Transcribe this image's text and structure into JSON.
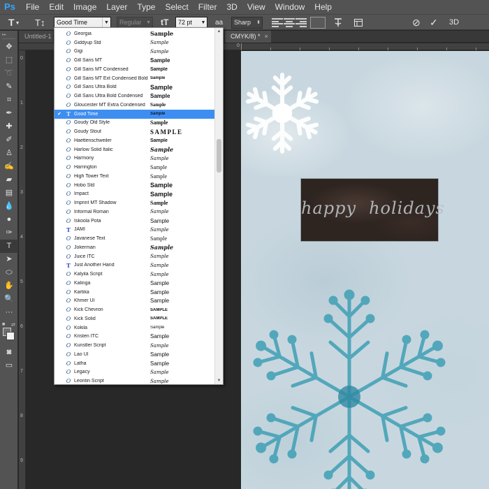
{
  "app": {
    "logo": "Ps"
  },
  "menu": [
    "File",
    "Edit",
    "Image",
    "Layer",
    "Type",
    "Select",
    "Filter",
    "3D",
    "View",
    "Window",
    "Help"
  ],
  "options": {
    "tool_preset": "T",
    "orientation_icon": "T↕",
    "font_family": "Good Time",
    "font_style": "Regular",
    "size_icon": "tT",
    "font_size": "72 pt",
    "aa_icon": "aa",
    "anti_alias": "Sharp",
    "align_options": [
      "align-left",
      "align-center",
      "align-right"
    ],
    "text_color": "#595959",
    "cancel_icon": "⊘",
    "commit_icon": "✓",
    "threed_label": "3D"
  },
  "tabs": [
    {
      "label": "Untitled-1"
    },
    {
      "label": "CMYK/8) *",
      "close": "×"
    }
  ],
  "rulers": {
    "top": [
      "0"
    ],
    "left": [
      "0",
      "1",
      "2",
      "3",
      "4",
      "5",
      "6",
      "7",
      "8",
      "9"
    ]
  },
  "tools": [
    "move",
    "marquee",
    "lasso",
    "quick-select",
    "crop",
    "eyedropper",
    "healing",
    "brush",
    "stamp",
    "history-brush",
    "eraser",
    "gradient",
    "blur",
    "dodge",
    "pen",
    "type",
    "path-select",
    "shape",
    "hand",
    "zoom"
  ],
  "canvas": {
    "text_word1": "happy",
    "text_word2": "holidays",
    "colors": {
      "background": "#c8d7df",
      "box": "#2e2420",
      "snow_blue": "#3f9fb5",
      "snow_white": "#ffffff"
    }
  },
  "font_menu": {
    "selected": "Good Time",
    "fonts": [
      {
        "name": "Georgia",
        "sample": "Sample",
        "type": "opentype"
      },
      {
        "name": "Giddyup Std",
        "sample": "Sample",
        "type": "opentype"
      },
      {
        "name": "Gigi",
        "sample": "Sample",
        "type": "opentype"
      },
      {
        "name": "Gill Sans MT",
        "sample": "Sample",
        "type": "opentype"
      },
      {
        "name": "Gill Sans MT Condensed",
        "sample": "Sample",
        "type": "opentype"
      },
      {
        "name": "Gill Sans MT Ext Condensed Bold",
        "sample": "Sample",
        "type": "opentype"
      },
      {
        "name": "Gill Sans Ultra Bold",
        "sample": "Sample",
        "type": "opentype"
      },
      {
        "name": "Gill Sans Ultra Bold Condensed",
        "sample": "Sample",
        "type": "opentype"
      },
      {
        "name": "Gloucester MT Extra Condensed",
        "sample": "Sample",
        "type": "opentype"
      },
      {
        "name": "Good Time",
        "sample": "Sample",
        "type": "truetype",
        "checked": true
      },
      {
        "name": "Goudy Old Style",
        "sample": "Sample",
        "type": "opentype"
      },
      {
        "name": "Goudy Stout",
        "sample": "SAMPLE",
        "type": "opentype"
      },
      {
        "name": "Haettenschweiler",
        "sample": "Sample",
        "type": "opentype"
      },
      {
        "name": "Harlow Solid Italic",
        "sample": "Sample",
        "type": "opentype"
      },
      {
        "name": "Harmony",
        "sample": "Sample",
        "type": "opentype"
      },
      {
        "name": "Harrington",
        "sample": "Sample",
        "type": "opentype"
      },
      {
        "name": "High Tower Text",
        "sample": "Sample",
        "type": "opentype"
      },
      {
        "name": "Hobo Std",
        "sample": "Sample",
        "type": "opentype"
      },
      {
        "name": "Impact",
        "sample": "Sample",
        "type": "opentype"
      },
      {
        "name": "Imprint MT Shadow",
        "sample": "Sample",
        "type": "opentype"
      },
      {
        "name": "Informal Roman",
        "sample": "Sample",
        "type": "opentype"
      },
      {
        "name": "Iskoola Pota",
        "sample": "Sample",
        "type": "opentype"
      },
      {
        "name": "JAMI",
        "sample": "Sample",
        "type": "truetype"
      },
      {
        "name": "Javanese Text",
        "sample": "Sample",
        "type": "opentype"
      },
      {
        "name": "Jokerman",
        "sample": "Sample",
        "type": "opentype"
      },
      {
        "name": "Juice ITC",
        "sample": "Sample",
        "type": "opentype"
      },
      {
        "name": "Just Another Hand",
        "sample": "Sample",
        "type": "truetype"
      },
      {
        "name": "Kalyila Script",
        "sample": "Sample",
        "type": "opentype"
      },
      {
        "name": "Kalinga",
        "sample": "Sample",
        "type": "opentype"
      },
      {
        "name": "Kartika",
        "sample": "Sample",
        "type": "opentype"
      },
      {
        "name": "Khmer UI",
        "sample": "Sample",
        "type": "opentype"
      },
      {
        "name": "Kick Chevron",
        "sample": "SAMPLE",
        "type": "opentype"
      },
      {
        "name": "Kick Solid",
        "sample": "SAMPLE",
        "type": "opentype"
      },
      {
        "name": "Kokila",
        "sample": "Sample",
        "type": "opentype"
      },
      {
        "name": "Kristen ITC",
        "sample": "Sample",
        "type": "opentype"
      },
      {
        "name": "Kunstler Script",
        "sample": "Sample",
        "type": "opentype"
      },
      {
        "name": "Lao UI",
        "sample": "Sample",
        "type": "opentype"
      },
      {
        "name": "Latha",
        "sample": "Sample",
        "type": "opentype"
      },
      {
        "name": "Legacy",
        "sample": "Sample",
        "type": "opentype"
      },
      {
        "name": "Leontin Script",
        "sample": "Sample",
        "type": "opentype"
      }
    ]
  }
}
